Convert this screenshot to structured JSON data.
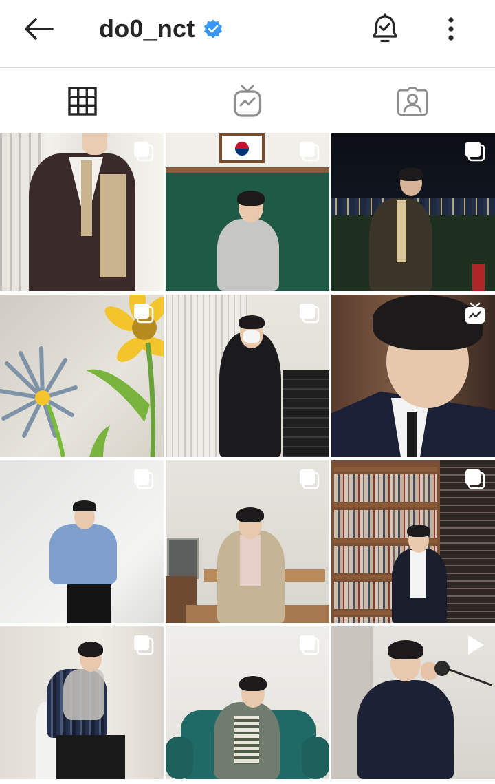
{
  "header": {
    "username": "do0_nct",
    "verified": true,
    "icons": {
      "back": "arrow-left-icon",
      "verified": "verified-badge-icon",
      "notifications": "bell-check-icon",
      "more": "more-vertical-icon"
    }
  },
  "tabs": [
    {
      "name": "posts",
      "icon": "grid-icon",
      "active": true
    },
    {
      "name": "igtv",
      "icon": "igtv-icon",
      "active": false
    },
    {
      "name": "tagged",
      "icon": "tagged-user-icon",
      "active": false
    }
  ],
  "posts": [
    {
      "row": 1,
      "col": 1,
      "badge": "carousel-icon"
    },
    {
      "row": 1,
      "col": 2,
      "badge": "carousel-icon"
    },
    {
      "row": 1,
      "col": 3,
      "badge": "carousel-icon"
    },
    {
      "row": 2,
      "col": 1,
      "badge": "carousel-icon"
    },
    {
      "row": 2,
      "col": 2,
      "badge": "carousel-icon"
    },
    {
      "row": 2,
      "col": 3,
      "badge": "igtv-icon"
    },
    {
      "row": 3,
      "col": 1,
      "badge": "carousel-icon"
    },
    {
      "row": 3,
      "col": 2,
      "badge": "carousel-icon"
    },
    {
      "row": 3,
      "col": 3,
      "badge": "carousel-icon"
    },
    {
      "row": 4,
      "col": 1,
      "badge": "carousel-icon"
    },
    {
      "row": 4,
      "col": 2,
      "badge": "carousel-icon"
    },
    {
      "row": 4,
      "col": 3,
      "badge": "play-icon"
    }
  ],
  "colors": {
    "text": "#262626",
    "verified": "#3897f0",
    "divider": "#dbdbdb",
    "icon_inactive": "#8e8e8e"
  }
}
